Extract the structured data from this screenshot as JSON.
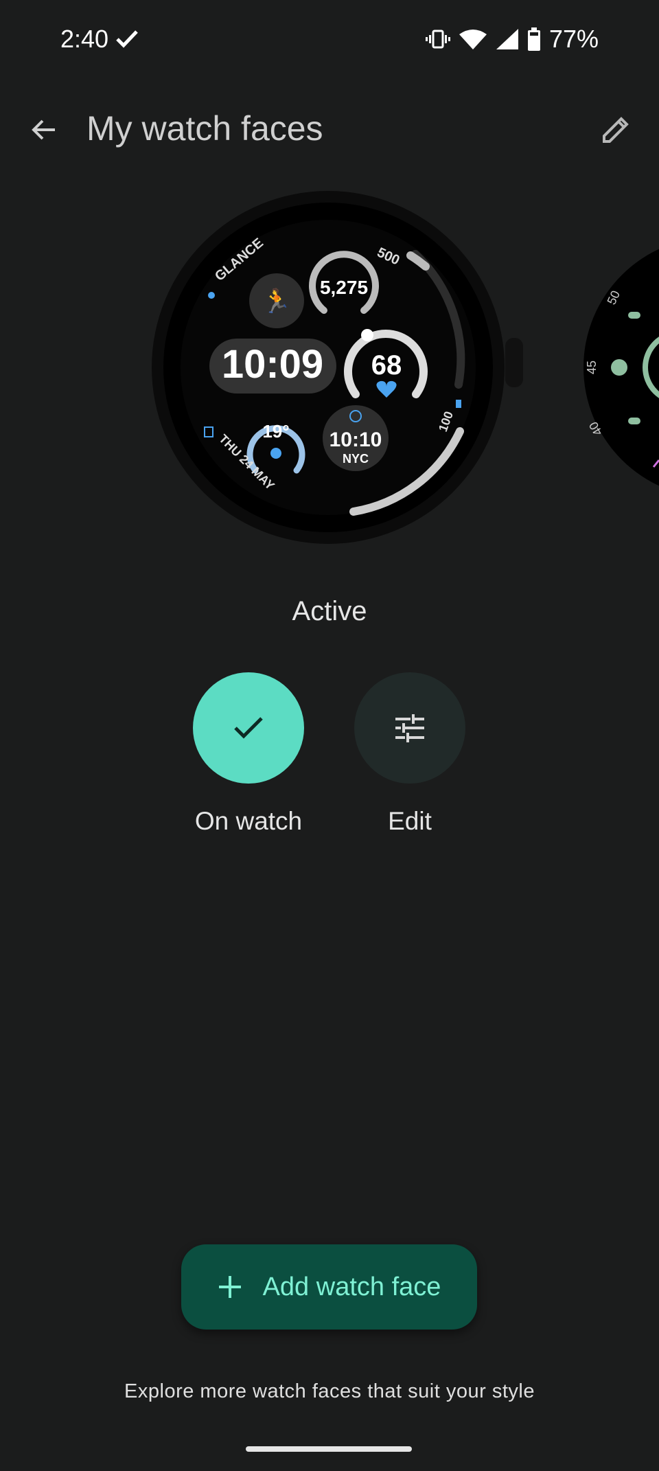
{
  "status_bar": {
    "time": "2:40",
    "battery": "77%",
    "icons": [
      "check-icon",
      "vibrate-icon",
      "wifi-icon",
      "signal-icon",
      "battery-icon"
    ]
  },
  "header": {
    "title": "My watch faces",
    "back_icon": "arrow-left-icon",
    "edit_icon": "pencil-icon"
  },
  "watch_face": {
    "complications": {
      "glance": "GLANCE",
      "calories": "500",
      "steps": "5,275",
      "time": "10:09",
      "heart_rate": "68",
      "weather": "19°",
      "world_time": "10:10",
      "world_city": "NYC",
      "date": "THU 24 MAY",
      "battery": "100"
    },
    "next_face_ticks": [
      "50",
      "45",
      "40"
    ]
  },
  "status_label": "Active",
  "actions": {
    "on_watch": "On watch",
    "edit": "Edit"
  },
  "add_button": {
    "label": "Add watch face",
    "icon": "plus-icon"
  },
  "footer_text": "Explore more watch faces that suit your style",
  "colors": {
    "background": "#1b1c1c",
    "accent": "#5cdcc3",
    "add_button_bg": "#0b4f40",
    "add_button_text": "#7ff1d4",
    "complication_blue": "#4aa3f0"
  }
}
